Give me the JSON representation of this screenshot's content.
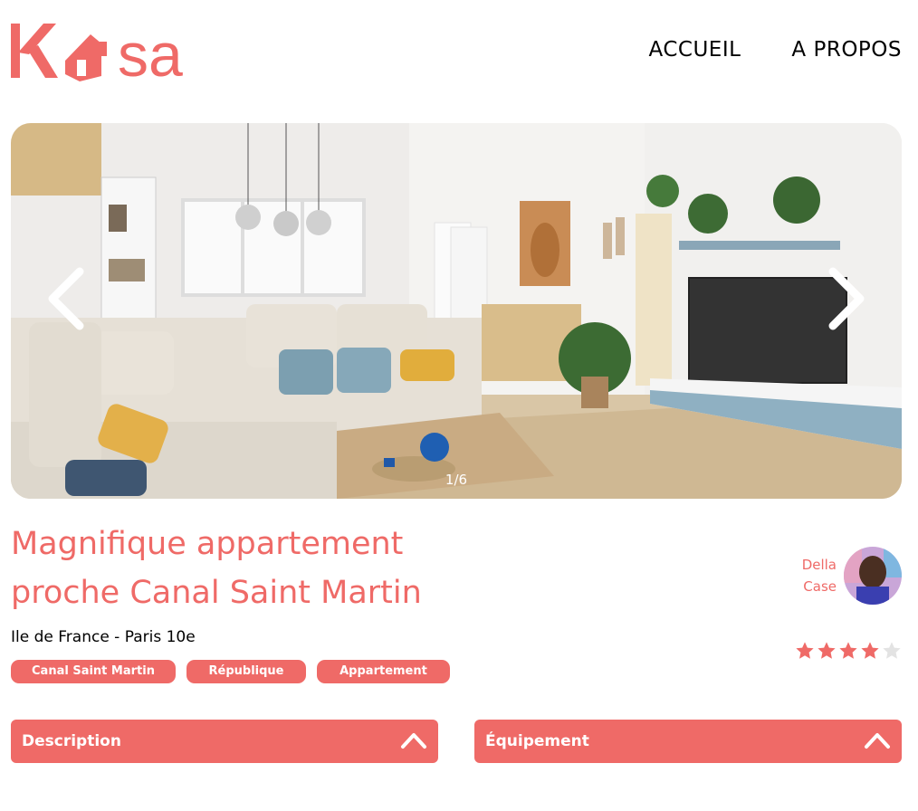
{
  "brand": {
    "name": "Kasa",
    "color": "#ef6a67"
  },
  "nav": {
    "home": "ACCUEIL",
    "about": "A PROPOS"
  },
  "gallery": {
    "counter": "1/6",
    "prev_icon": "chevron-left-icon",
    "next_icon": "chevron-right-icon"
  },
  "listing": {
    "title": "Magnifique appartement proche Canal Saint Martin",
    "location": "Ile de France - Paris 10e",
    "tags": [
      "Canal Saint Martin",
      "République",
      "Appartement"
    ]
  },
  "host": {
    "first_name": "Della",
    "last_name": "Case"
  },
  "rating": {
    "value": 4,
    "max": 5,
    "filled_color": "#ef6a67",
    "empty_color": "#e3e3e3"
  },
  "sections": {
    "description": "Description",
    "equipment": "Équipement"
  }
}
